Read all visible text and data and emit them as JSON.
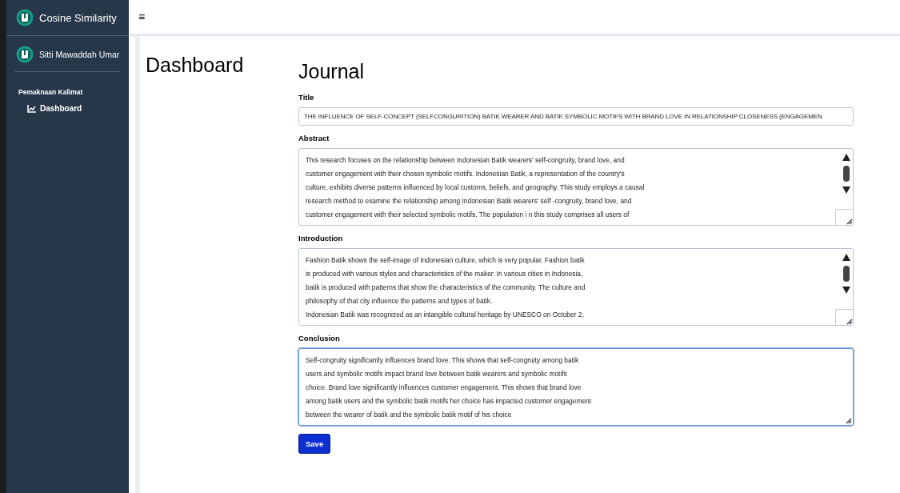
{
  "sidebar": {
    "brand": "Cosine Similarity",
    "user": "Sitti Mawaddah Umar",
    "section": "Pemaknaan Kalimat",
    "items": [
      {
        "label": "Dashboard",
        "selected": true
      }
    ]
  },
  "topbar": {
    "menu_glyph": "≡"
  },
  "page_title": "Dashboard",
  "journal": {
    "heading": "Journal",
    "fields": [
      {
        "kind": "input",
        "label": "Title",
        "value": "THE INFLUENCE OF SELF-CONCEPT (SELFCONGURITION) BATIK WEARER AND BATIK SYMBOLIC MOTIFS WITH BRAND LOVE IN RELATIONSHIP CLOSENESS (ENGAGEMEN",
        "focused": false
      },
      {
        "kind": "textarea",
        "label": "Abstract",
        "focused": false,
        "scrollable": true,
        "lines": [
          "This research focuses on the relationship between Indonesian Batik wearers' self-congruity, brand love, and",
          "customer engagement with their chosen symbolic motifs. Indonesian Batik, a representation of the country's",
          "culture, exhibits diverse patterns influenced by local customs, beliefs, and geography. This study employs a causal",
          "research method to examine the relationship among Indonesian Batik wearers' self -congruity, brand love, and",
          "customer engagement with their selected symbolic motifs. The population i n this study comprises all users of"
        ]
      },
      {
        "kind": "textarea",
        "label": "Introduction",
        "focused": false,
        "scrollable": true,
        "lines": [
          "Fashion Batik shows the self-image of Indonesian culture, which is very popular. Fashion batik",
          "is produced with various styles and characteristics of the maker. In various cities in Indonesia,",
          "batik is produced with patterns that show the characteristics of the community. The culture and",
          "philosophy of that city influence the patterns and types of batik.",
          "Indonesian Batik was recognized as an intangible cultural heritage by UNESCO on October 2,"
        ]
      },
      {
        "kind": "textarea",
        "label": "Conclusion",
        "focused": true,
        "scrollable": false,
        "lines": [
          "Self-congruity significantly influences brand love. This shows that self-congruity among batik",
          "users and symbolic motifs impact brand love between batik wearers and symbolic motifs",
          "choice. Brand love significantly influences customer engagement. This shows that brand love",
          "among batik users and the symbolic batik motifs her choice has impacted customer engagement",
          "between the wearer of batik and the symbolic batik motif of his choice"
        ]
      }
    ],
    "save_button": "Save"
  }
}
